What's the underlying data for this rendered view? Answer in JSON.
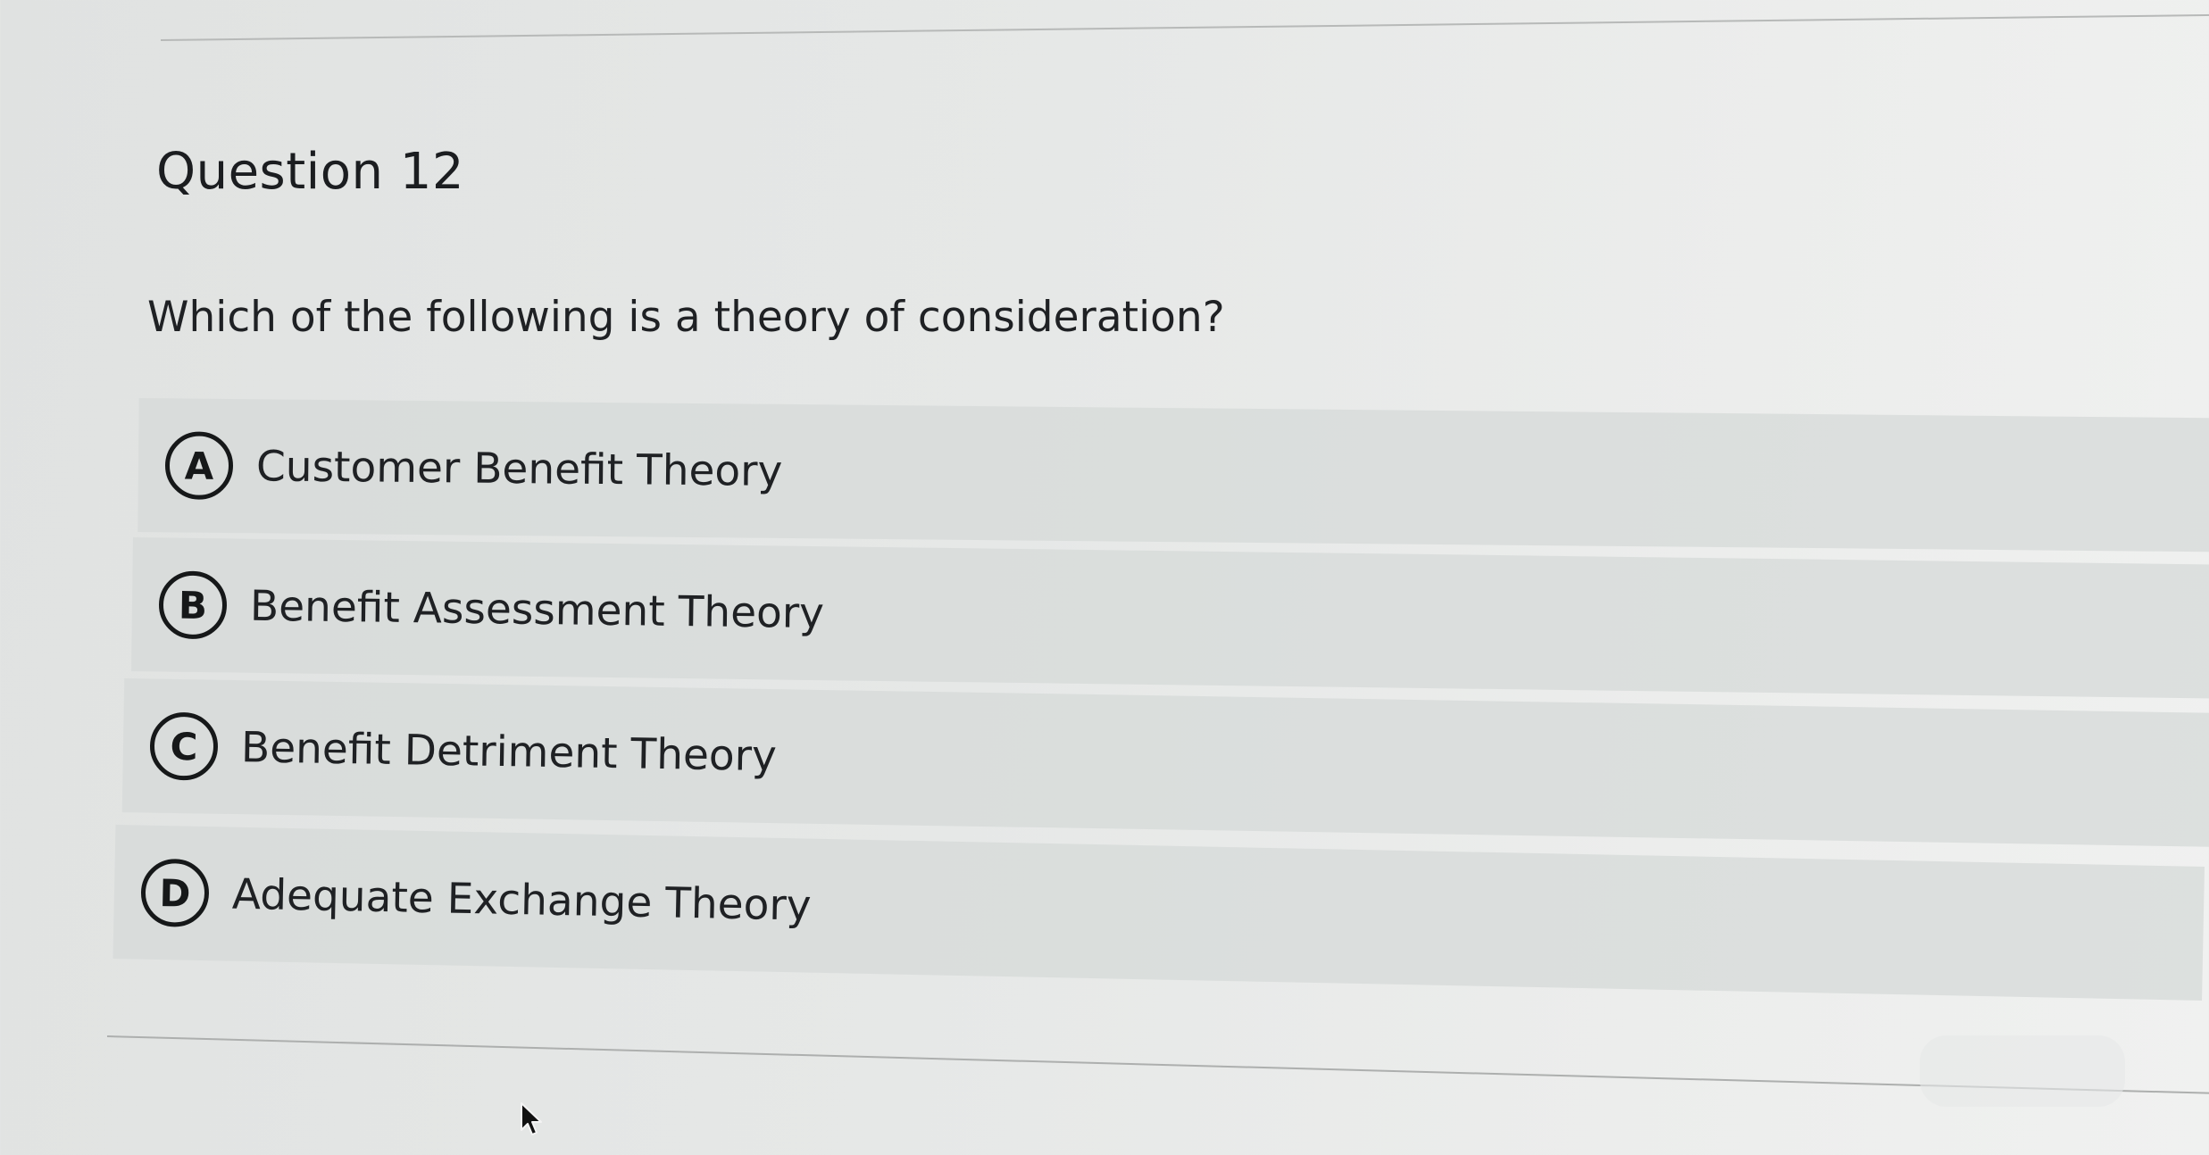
{
  "question": {
    "title": "Question 12",
    "prompt": "Which of the following is a theory of consideration?"
  },
  "options": [
    {
      "letter": "A",
      "label": "Customer Benefit Theory"
    },
    {
      "letter": "B",
      "label": "Benefit Assessment Theory"
    },
    {
      "letter": "C",
      "label": "Benefit Detriment Theory"
    },
    {
      "letter": "D",
      "label": "Adequate Exchange Theory"
    }
  ],
  "icons": {
    "pointer": "mouse-pointer-icon"
  }
}
